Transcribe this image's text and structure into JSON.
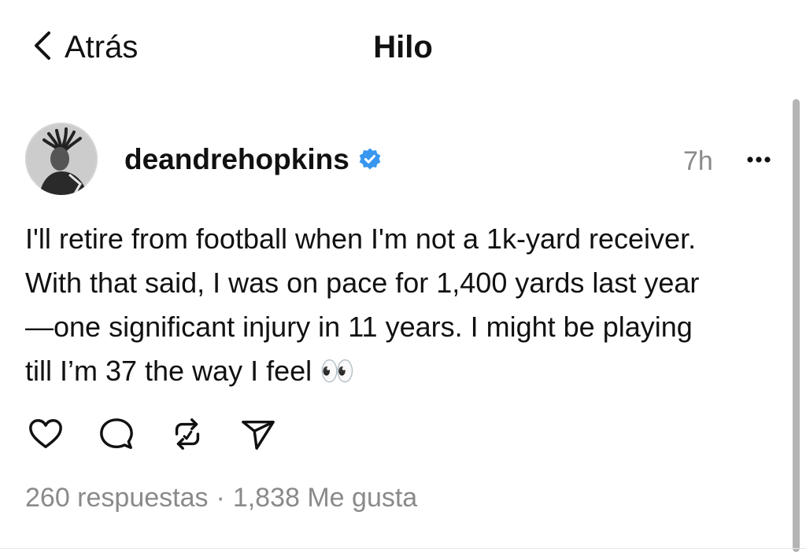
{
  "header": {
    "back_label": "Atrás",
    "title": "Hilo"
  },
  "post": {
    "username": "deandrehopkins",
    "verified": true,
    "time": "7h",
    "text": "I'll retire from football when I'm not a 1k-yard receiver.\nWith that said, I was on pace for 1,400 yards last year\n—one significant injury in 11 years. I might be playing\ntill I’m 37 the way I feel 👀",
    "replies_label": "260 respuestas",
    "separator": "·",
    "likes_label": "1,838 Me gusta"
  },
  "icons": {
    "back": "chevron-left-icon",
    "verified": "verified-badge-icon",
    "more": "more-horizontal-icon",
    "like": "heart-icon",
    "reply": "comment-icon",
    "repost": "repost-icon",
    "share": "send-icon"
  },
  "colors": {
    "accent_verified": "#3897f0",
    "muted_text": "#8a8a8a",
    "text": "#111111"
  }
}
